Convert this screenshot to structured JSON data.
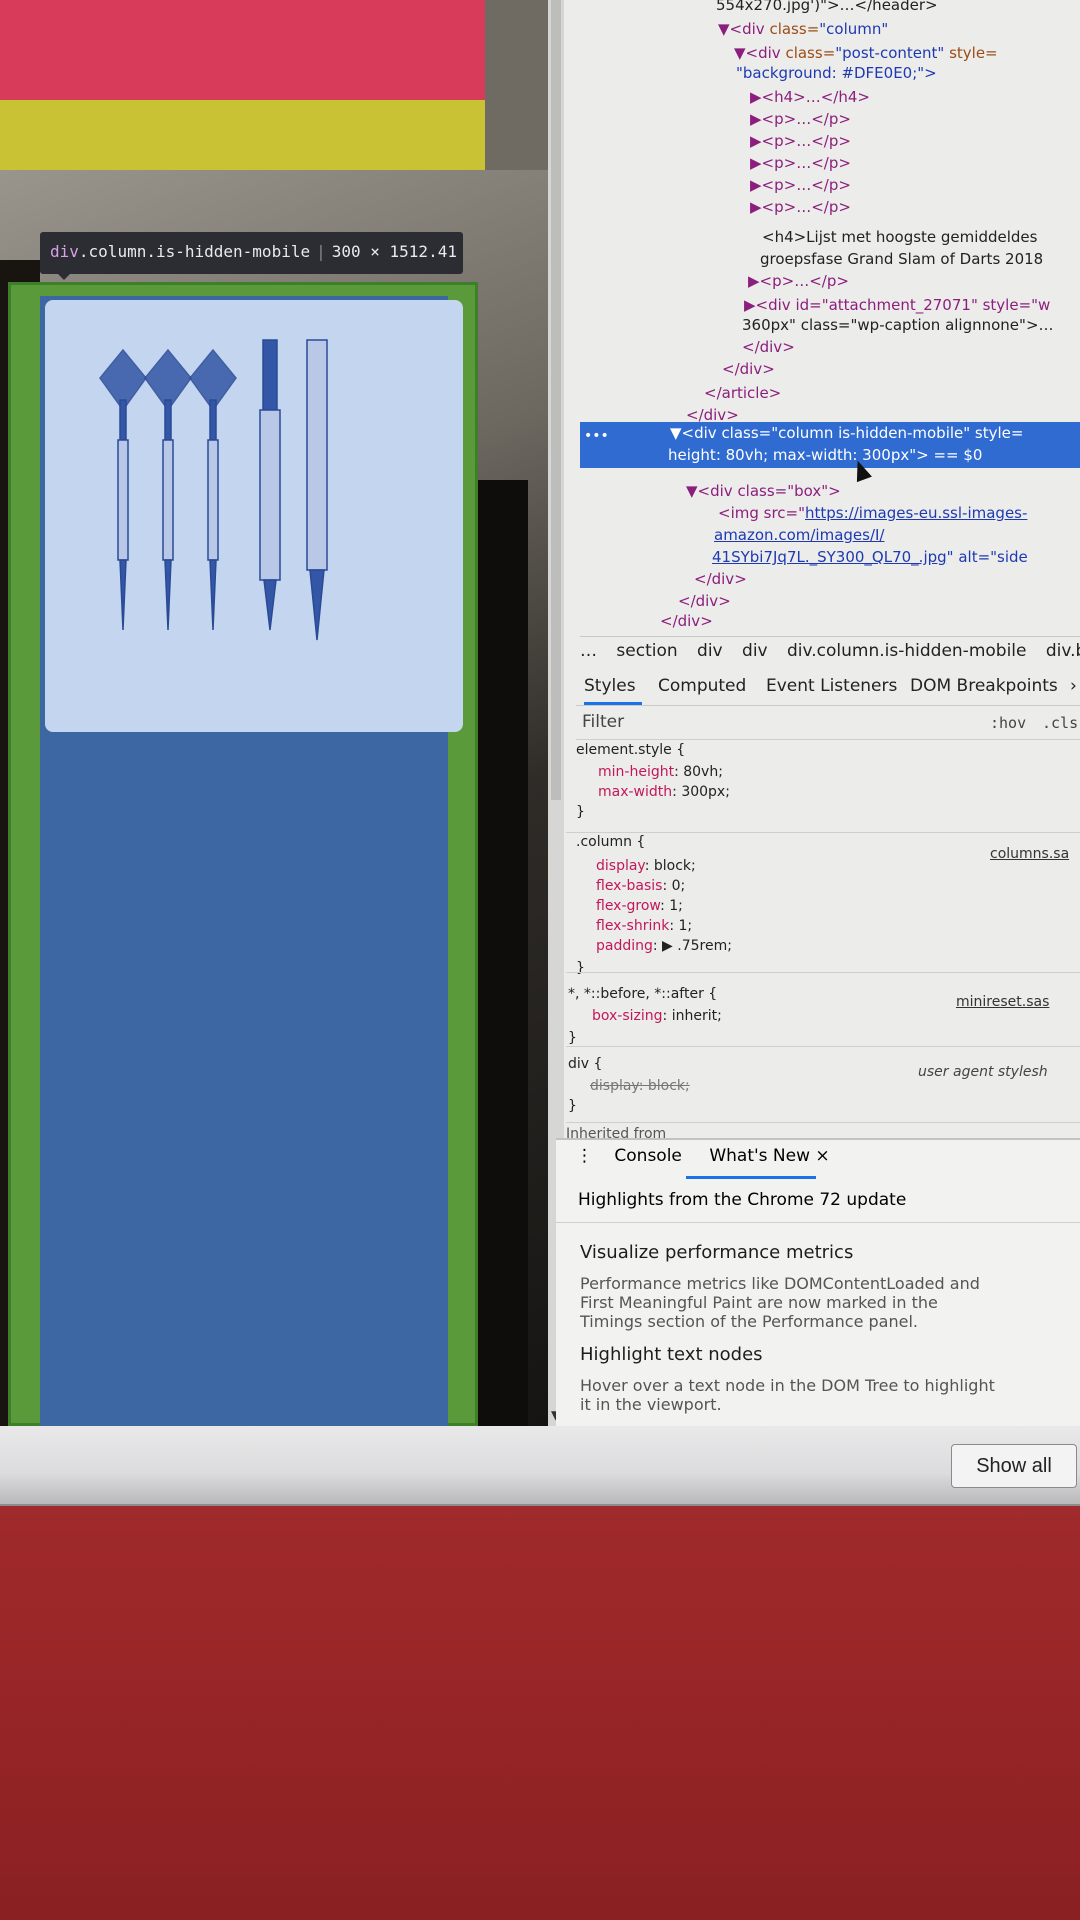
{
  "left_page": {
    "tooltip": {
      "tag": "div",
      "classes": ".column.is-hidden-mobile",
      "size": "300 × 1512.41"
    }
  },
  "devtools": {
    "dom": {
      "l1": "554x270.jpg')\">…</header>",
      "l2_tag": "▼<div ",
      "l2_attr": "class=",
      "l2_val": "\"column\"",
      "l3_tag": "▼<div ",
      "l3_attr": "class=",
      "l3_val": "\"post-content\" ",
      "l3_style": "style=",
      "l4": "\"background: #DFE0E0;\">",
      "h4_collapsed": "▶<h4>…</h4>",
      "p1": "▶<p>…</p>",
      "p2": "▶<p>…</p>",
      "p3": "▶<p>…</p>",
      "p4": "▶<p>…</p>",
      "p5": "▶<p>…</p>",
      "h4_text_a": "<h4>Lijst met hoogste gemiddeldes",
      "h4_text_b": "groepsfase Grand Slam of Darts 2018",
      "p6": "▶<p>…</p>",
      "attach_a": "▶<div id=\"attachment_27071\" style=\"w",
      "attach_b": "360px\" class=\"wp-caption alignnone\">…",
      "close1": "</div>",
      "close2": "</div>",
      "close_article": "</article>",
      "close3": "</div>",
      "sel_a": "▼<div class=\"column is-hidden-mobile\" style=",
      "sel_b": "height: 80vh; max-width: 300px\"> == $0",
      "box_open": "▼<div class=\"box\">",
      "img_a": "<img src=\"",
      "img_link1": "https://images-eu.ssl-images-",
      "img_link2": "amazon.com/images/I/",
      "img_link3": "41SYbi7Jq7L._SY300_QL70_.jpg",
      "img_alt": "\" alt=\"side",
      "close_box": "</div>",
      "close4": "</div>",
      "close5": "</div>"
    },
    "breadcrumbs": [
      "…",
      "section",
      "div",
      "div",
      "div.column.is-hidden-mobile",
      "div.box"
    ],
    "tabs": [
      "Styles",
      "Computed",
      "Event Listeners",
      "DOM Breakpoints",
      "›"
    ],
    "filter": {
      "placeholder": "Filter",
      "hov": ":hov",
      "cls": ".cls"
    },
    "css": {
      "r1_sel": "element.style {",
      "r1_p1n": "min-height",
      "r1_p1v": ": 80vh;",
      "r1_p2n": "max-width",
      "r1_p2v": ": 300px;",
      "r1_close": "}",
      "r2_sel": ".column {",
      "r2_src": "columns.sa",
      "r2_p1n": "display",
      "r2_p1v": ": block;",
      "r2_p2n": "flex-basis",
      "r2_p2v": ": 0;",
      "r2_p3n": "flex-grow",
      "r2_p3v": ": 1;",
      "r2_p4n": "flex-shrink",
      "r2_p4v": ": 1;",
      "r2_p5n": "padding",
      "r2_p5v": ": ▶ .75rem;",
      "r2_close": "}",
      "r3_sel": "*, *::before, *::after {",
      "r3_src": "minireset.sas",
      "r3_p1n": "box-sizing",
      "r3_p1v": ": inherit;",
      "r3_close": "}",
      "r4_sel": "div {",
      "r4_src": "user agent stylesh",
      "r4_p1": "display: block;",
      "r4_close": "}",
      "inherited": "Inherited from"
    },
    "drawer": {
      "menu": "⋮",
      "tab_console": "Console",
      "tab_whatsnew": "What's New ×",
      "title": "Highlights from the Chrome 72 update",
      "h1": "Visualize performance metrics",
      "p1a": "Performance metrics like DOMContentLoaded and",
      "p1b": "First Meaningful Paint are now marked in the",
      "p1c": "Timings section of the Performance panel.",
      "h2": "Highlight text nodes",
      "p2a": "Hover over a text node in the DOM Tree to highlight",
      "p2b": "it in the viewport."
    }
  },
  "bottom": {
    "show_all": "Show all"
  },
  "colors": {
    "selection": "#2f6bd1",
    "highlight_green": "#5a9a3a",
    "highlight_blue": "#3d67a2",
    "accent": "#1a73e8"
  }
}
